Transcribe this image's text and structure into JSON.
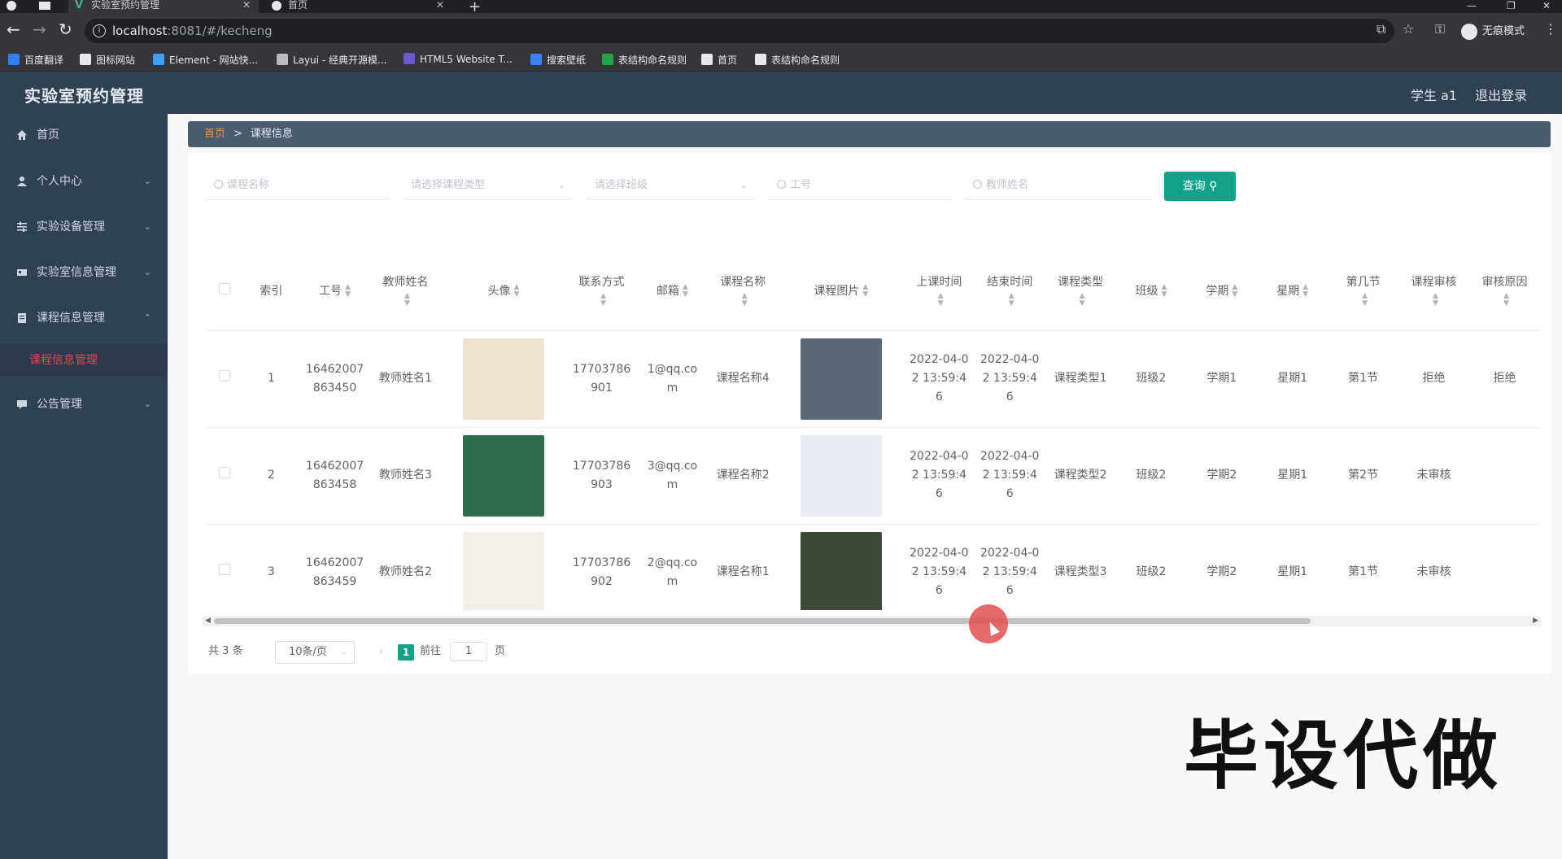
{
  "browser": {
    "tabs": [
      {
        "title": "实验室预约管理",
        "icon": "vue-icon",
        "active": true
      },
      {
        "title": "首页",
        "icon": "globe-icon",
        "active": false
      }
    ],
    "url_host": "localhost",
    "url_rest": ":8081/#/kecheng",
    "incognito_label": "无痕模式",
    "bookmarks": [
      {
        "label": "百度翻译",
        "icon_color": "#2f7ef2"
      },
      {
        "label": "图标网站",
        "icon_color": "#e8e8e8"
      },
      {
        "label": "Element - 网站快...",
        "icon_color": "#409eff"
      },
      {
        "label": "Layui - 经典开源模...",
        "icon_color": "#bbbbbb"
      },
      {
        "label": "HTML5 Website T...",
        "icon_color": "#6a5acd"
      },
      {
        "label": "搜索壁纸",
        "icon_color": "#3b82f6"
      },
      {
        "label": "表结构命名规则",
        "icon_color": "#22a34a"
      },
      {
        "label": "首页",
        "icon_color": "#e8e8e8"
      },
      {
        "label": "表结构命名规则",
        "icon_color": "#e8e8e8"
      }
    ]
  },
  "header": {
    "title": "实验室预约管理",
    "user": "学生 a1",
    "logout": "退出登录"
  },
  "sidebar": {
    "items": [
      {
        "label": "首页",
        "icon": "home-icon"
      },
      {
        "label": "个人中心",
        "icon": "user-icon"
      },
      {
        "label": "实验设备管理",
        "icon": "sliders-icon"
      },
      {
        "label": "实验室信息管理",
        "icon": "lab-icon"
      },
      {
        "label": "课程信息管理",
        "icon": "document-icon"
      },
      {
        "label": "公告管理",
        "icon": "message-icon"
      }
    ],
    "active_sub": "课程信息管理"
  },
  "breadcrumb": {
    "home": "首页",
    "separator": ">",
    "current": "课程信息"
  },
  "filters": {
    "course_name_placeholder": "课程名称",
    "course_type_placeholder": "请选择课程类型",
    "class_placeholder": "请选择班级",
    "work_no_placeholder": "工号",
    "teacher_name_placeholder": "教师姓名",
    "query_label": "查询"
  },
  "table": {
    "columns": {
      "index": "索引",
      "work_no": "工号",
      "teacher_name": "教师姓名",
      "avatar": "头像",
      "phone": "联系方式",
      "email": "邮箱",
      "course_name": "课程名称",
      "course_image": "课程图片",
      "start_time": "上课时间",
      "end_time": "结束时间",
      "course_type": "课程类型",
      "class": "班级",
      "semester": "学期",
      "weekday": "星期",
      "period": "第几节",
      "review": "课程审核",
      "review_reason": "审核原因"
    },
    "rows": [
      {
        "index": "1",
        "work_no": "16462007863450",
        "teacher_name": "教师姓名1",
        "phone": "17703786901",
        "email": "1@qq.com",
        "course_name": "课程名称4",
        "start_time": "2022-04-02 13:59:46",
        "end_time": "2022-04-02 13:59:46",
        "course_type": "课程类型1",
        "class": "班级2",
        "semester": "学期1",
        "weekday": "星期1",
        "period": "第1节",
        "review": "拒绝",
        "review_reason": "拒绝",
        "avatar_color": "#efe3d4",
        "image_color": "#5c6a78"
      },
      {
        "index": "2",
        "work_no": "16462007863458",
        "teacher_name": "教师姓名3",
        "phone": "17703786903",
        "email": "3@qq.com",
        "course_name": "课程名称2",
        "start_time": "2022-04-02 13:59:46",
        "end_time": "2022-04-02 13:59:46",
        "course_type": "课程类型2",
        "class": "班级2",
        "semester": "学期2",
        "weekday": "星期1",
        "period": "第2节",
        "review": "未审核",
        "review_reason": "",
        "avatar_color": "#2e6b4f",
        "image_color": "#e9edf3"
      },
      {
        "index": "3",
        "work_no": "16462007863459",
        "teacher_name": "教师姓名2",
        "phone": "17703786902",
        "email": "2@qq.com",
        "course_name": "课程名称1",
        "start_time": "2022-04-02 13:59:46",
        "end_time": "2022-04-02 13:59:46",
        "course_type": "课程类型3",
        "class": "班级2",
        "semester": "学期2",
        "weekday": "星期1",
        "period": "第1节",
        "review": "未审核",
        "review_reason": "",
        "avatar_color": "#f2eee8",
        "image_color": "#3f4a3a"
      }
    ]
  },
  "pagination": {
    "total": "共 3 条",
    "page_size": "10条/页",
    "current_page": "1",
    "goto_label": "前往",
    "goto_value": "1",
    "page_suffix": "页"
  },
  "watermark": "毕设代做",
  "colors": {
    "primary": "#13a18c",
    "sidebar": "#304156",
    "active_menu": "#e0484a",
    "breadcrumb_home": "#f0913a"
  }
}
